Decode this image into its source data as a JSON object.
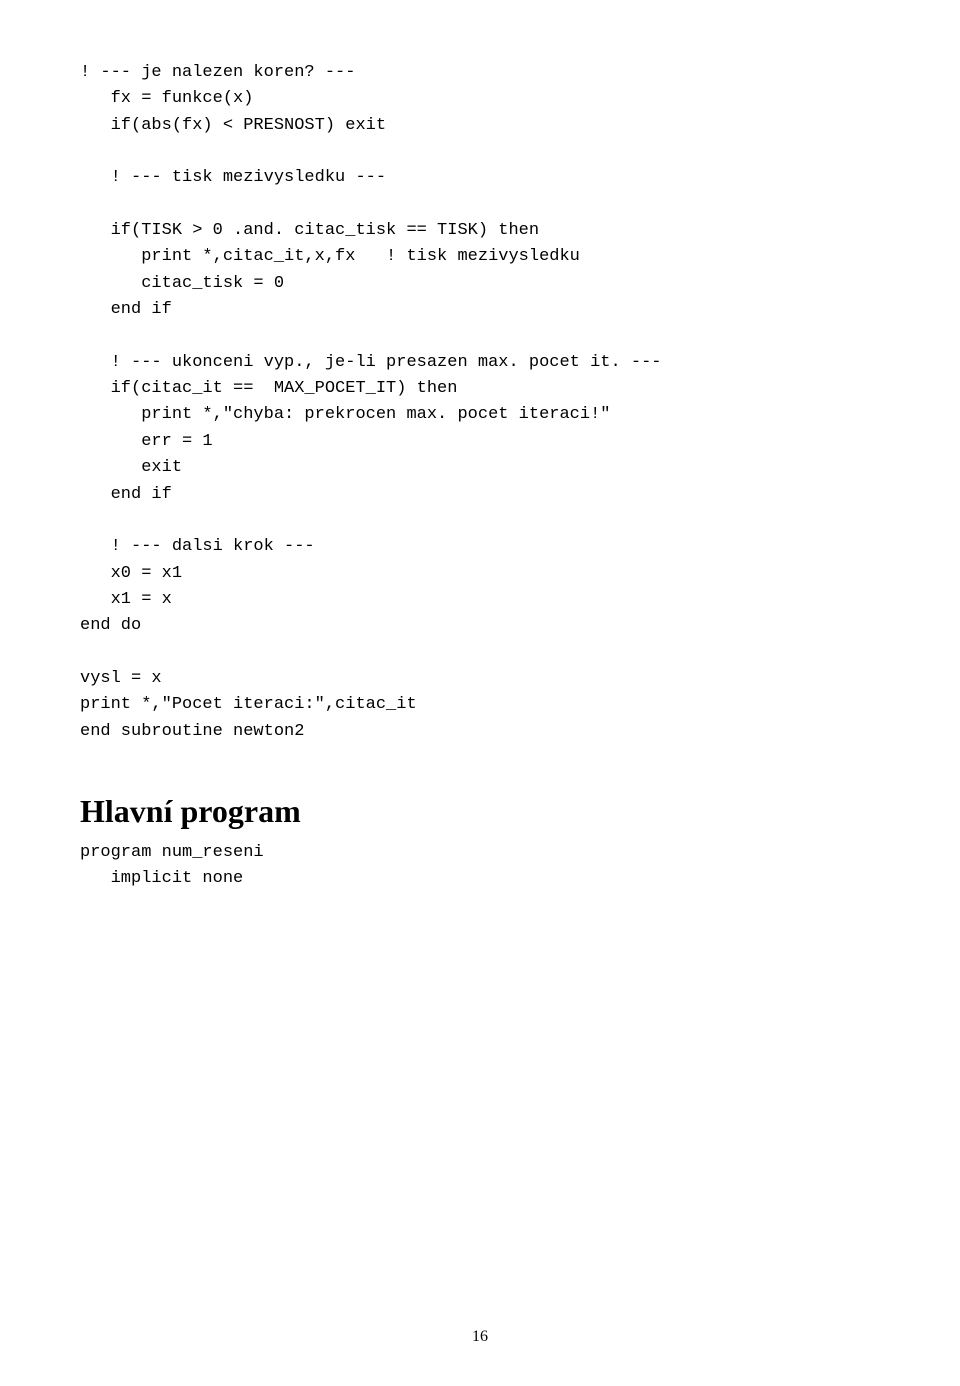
{
  "page": {
    "number": "16",
    "background": "#ffffff"
  },
  "code_content": {
    "lines": [
      "! --- je nalezen koren? ---",
      "   fx = funkce(x)",
      "   if(abs(fx) < PRESNOST) exit",
      "",
      "   ! --- tisk mezivysledku ---",
      "",
      "   if(TISK > 0 .and. citac_tisk == TISK) then",
      "      print *,citac_it,x,fx   ! tisk mezivysledku",
      "      citac_tisk = 0",
      "   end if",
      "",
      "   ! --- ukonceni vyp., je-li presazen max. pocet it. ---",
      "   if(citac_it ==  MAX_POCET_IT) then",
      "      print *,\"chyba: prekrocen max. pocet iteraci!\"",
      "      err = 1",
      "      exit",
      "   end if",
      "",
      "   ! --- dalsi krok ---",
      "   x0 = x1",
      "   x1 = x",
      "end do",
      "",
      "vysl = x",
      "print *,\"Pocet iteraci:\",citac_it",
      "end subroutine newton2"
    ]
  },
  "section": {
    "heading": "Hlavní program",
    "code_lines": [
      "program num_reseni",
      "   implicit none"
    ]
  }
}
